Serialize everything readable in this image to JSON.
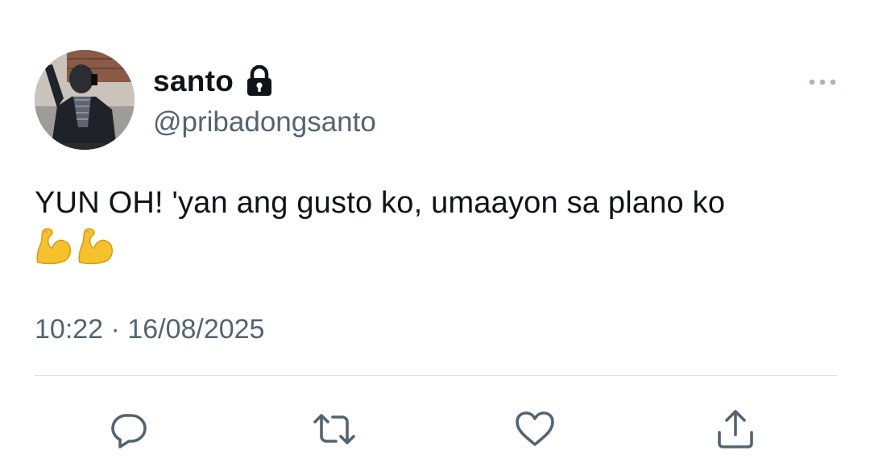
{
  "user": {
    "display_name": "santo",
    "handle": "@pribadongsanto",
    "avatar_icon": "avatar",
    "protected_icon": "lock-icon"
  },
  "tweet": {
    "text": "YUN OH! 'yan ang gusto ko, umaayon sa plano ko",
    "emojis": [
      "flexed-biceps",
      "flexed-biceps"
    ],
    "timestamp": "10:22 · 16/08/2025"
  },
  "actions": [
    {
      "name": "reply",
      "icon": "speech-bubble-icon"
    },
    {
      "name": "retweet",
      "icon": "retweet-icon"
    },
    {
      "name": "like",
      "icon": "heart-icon"
    },
    {
      "name": "share",
      "icon": "share-icon"
    }
  ],
  "colors": {
    "text": "#0f1419",
    "secondary": "#536471",
    "divider": "#dfe3e6",
    "emoji": "#f5c22b"
  }
}
